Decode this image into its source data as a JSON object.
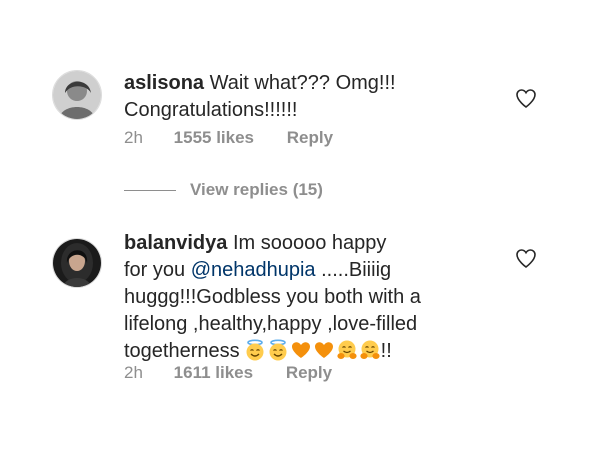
{
  "comments": [
    {
      "username": "aslisona",
      "text_first": " Wait what??? Omg!!!",
      "text_second": "Congratulations!!!!!!",
      "time": "2h",
      "likes": "1555 likes",
      "reply": "Reply",
      "view_replies": "View replies (15)"
    },
    {
      "username": "balanvidya",
      "text_line1": " Im sooooo happy",
      "text_line2_pre": "for you ",
      "mention": "@nehadhupia",
      "text_line2_post": " .....Biiiig",
      "text_line3": "huggg!!!Godbless you both with a",
      "text_line4": "lifelong ,healthy,happy ,love-filled",
      "text_line5": "togetherness",
      "text_after_emoji": "!!",
      "emojis": [
        "smiling-face-with-halo",
        "smiling-face-with-halo",
        "orange-heart",
        "orange-heart",
        "hugging-face",
        "hugging-face"
      ],
      "time": "2h",
      "likes": "1611 likes",
      "reply": "Reply"
    }
  ],
  "colors": {
    "text": "#262626",
    "muted": "#8e8e8e",
    "mention": "#003569",
    "heart_orange": "#f4900c",
    "emoji_yellow": "#ffcc4d"
  }
}
